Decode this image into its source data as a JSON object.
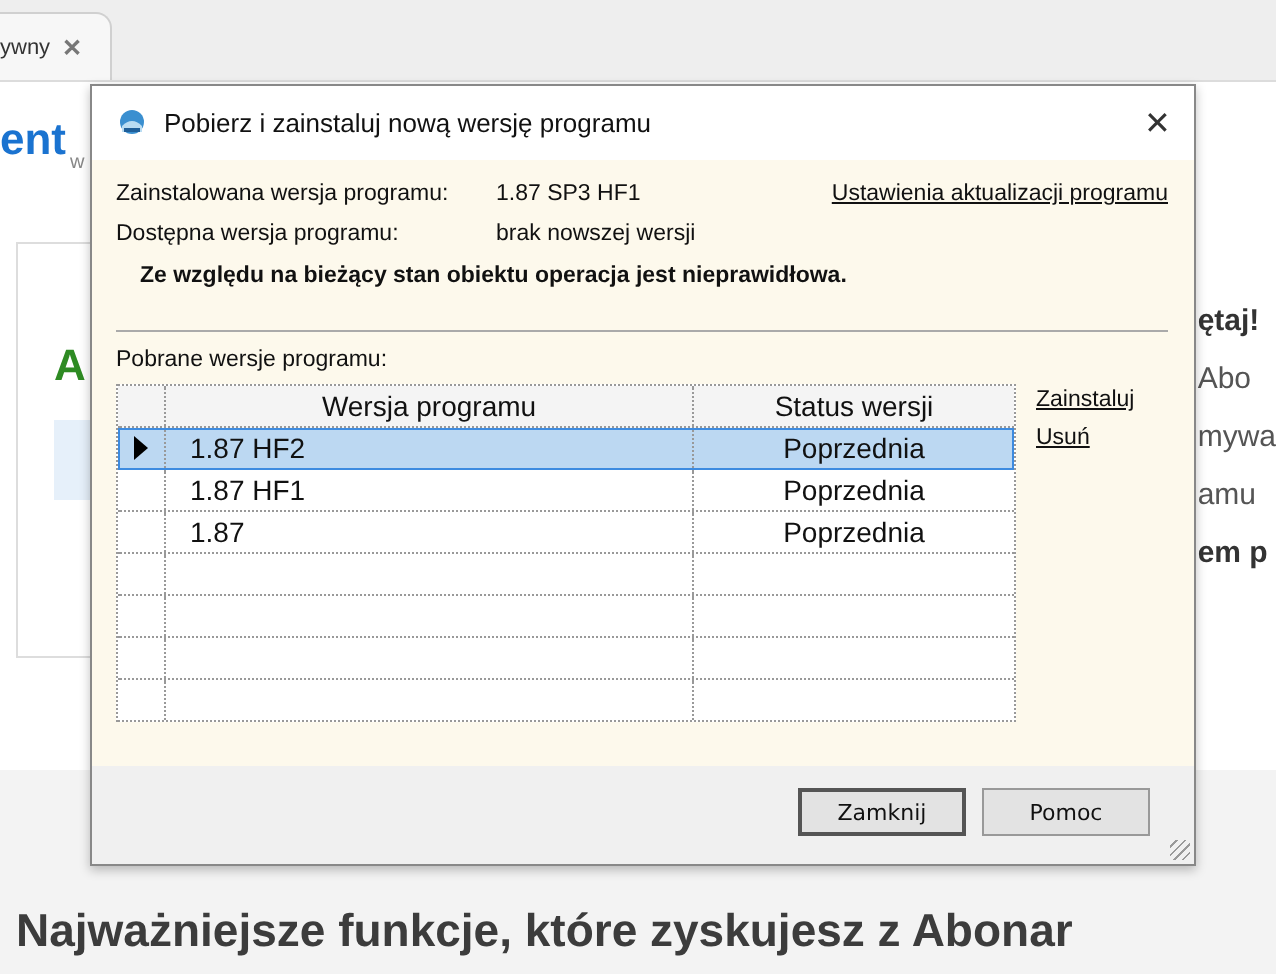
{
  "browser_tab": {
    "title": "ywny",
    "close": "✕"
  },
  "page": {
    "heading": "ent",
    "subtext": "w",
    "card_heading": "A",
    "right_lines": [
      {
        "text": "ętaj!",
        "bold": true
      },
      {
        "text": "Abo",
        "bold": false
      },
      {
        "text": "mywa",
        "bold": false
      },
      {
        "text": "amu",
        "bold": false
      },
      {
        "text": "em p",
        "bold": true
      }
    ],
    "section_heading": "Najważniejsze funkcje, które zyskujesz z Abonar"
  },
  "dialog": {
    "title": "Pobierz i zainstaluj nową wersję programu",
    "close": "✕",
    "info": [
      {
        "label": "Zainstalowana wersja programu:",
        "value": "1.87 SP3 HF1"
      },
      {
        "label": "Dostępna wersja programu:",
        "value": "brak nowszej wersji"
      }
    ],
    "settings_link": "Ustawienia aktualizacji programu",
    "message": "Ze względu na bieżący stan obiektu operacja jest nieprawidłowa.",
    "list_label": "Pobrane wersje programu:",
    "table": {
      "columns": [
        "Wersja programu",
        "Status wersji"
      ],
      "rows": [
        {
          "version": "1.87 HF2",
          "status": "Poprzednia",
          "selected": true
        },
        {
          "version": "1.87 HF1",
          "status": "Poprzednia",
          "selected": false
        },
        {
          "version": "1.87",
          "status": "Poprzednia",
          "selected": false
        }
      ]
    },
    "actions": [
      "Zainstaluj",
      "Usuń"
    ],
    "buttons": [
      {
        "label": "Zamknij",
        "default": true
      },
      {
        "label": "Pomoc",
        "default": false
      }
    ]
  }
}
